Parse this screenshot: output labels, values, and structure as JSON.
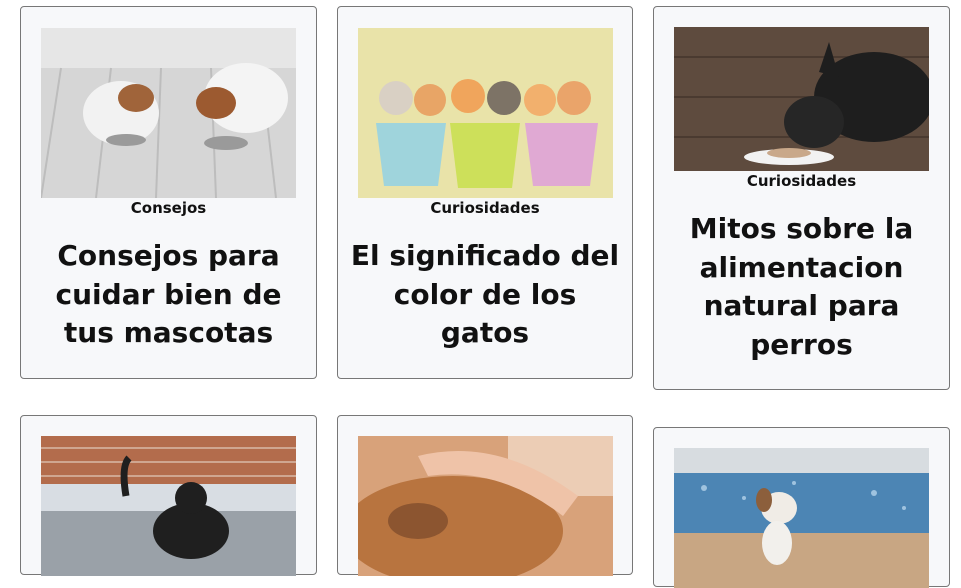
{
  "cards": [
    {
      "category": "Consejos",
      "title": "Consejos para cuidar bien de tus mascotas",
      "image_icon": "cat-and-dog-eating-photo",
      "image_colors": {
        "bg": "#c9c9c9",
        "accent": "#8a5a36"
      }
    },
    {
      "category": "Curiosidades",
      "title": "El significado del color de los gatos",
      "image_icon": "kittens-in-pots-photo",
      "image_colors": {
        "bg": "#e8e2a6",
        "accent": "#e89a4e"
      }
    },
    {
      "category": "Curiosidades",
      "title": "Mitos sobre la alimentacion natural para perros",
      "image_icon": "french-bulldog-eating-photo",
      "image_colors": {
        "bg": "#5c4a3e",
        "accent": "#1a1a1a"
      }
    },
    {
      "category": "",
      "title": "",
      "image_icon": "black-cat-photo",
      "image_colors": {
        "bg": "#b56a4a",
        "accent": "#222"
      }
    },
    {
      "category": "",
      "title": "",
      "image_icon": "dog-petted-photo",
      "image_colors": {
        "bg": "#c88b5a",
        "accent": "#e8b99a"
      }
    },
    {
      "category": "",
      "title": "",
      "image_icon": "beagle-beach-photo",
      "image_colors": {
        "bg": "#4f87b4",
        "accent": "#c9a884"
      }
    }
  ]
}
